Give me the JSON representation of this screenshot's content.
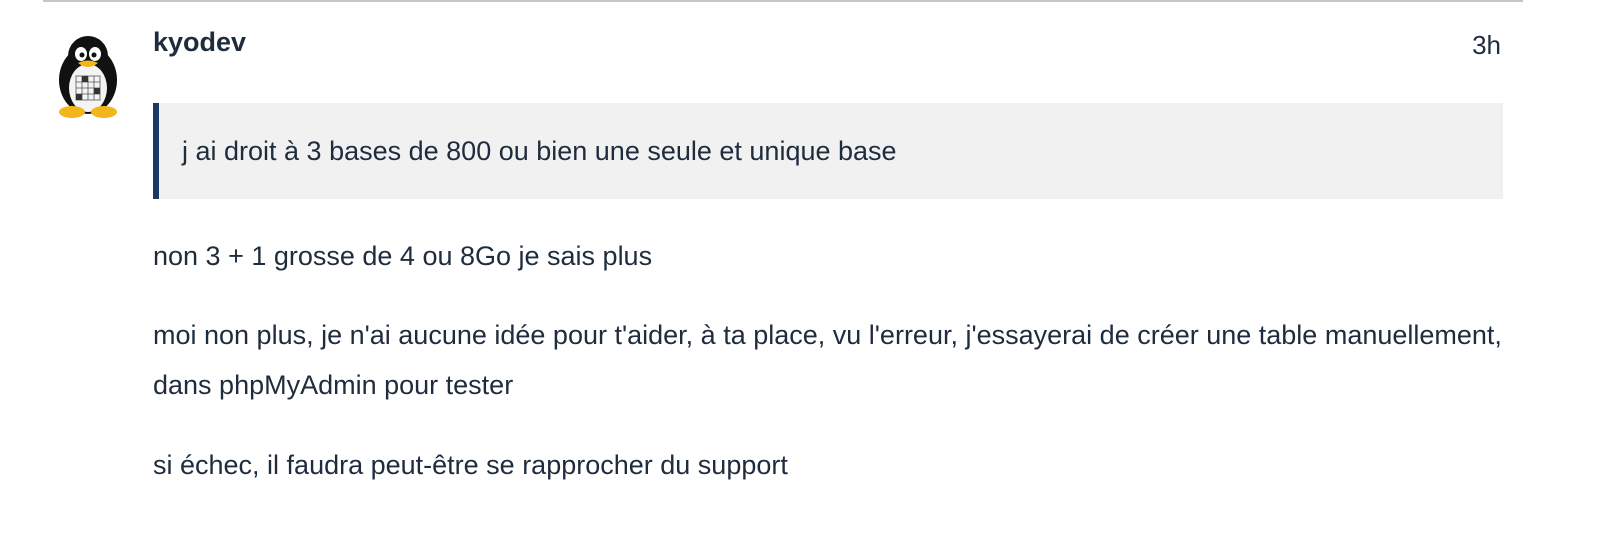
{
  "post": {
    "username": "kyodev",
    "date": "3h",
    "avatar_icon": "tux-penguin-avatar",
    "quote": "j ai droit à 3 bases de 800 ou bien une seule et unique base",
    "paragraphs": [
      "non 3 + 1 grosse de 4 ou 8Go je sais plus",
      "moi non plus, je n'ai aucune idée pour t'aider, à ta place, vu l'erreur, j'essayerai de créer une table manuellement, dans phpMyAdmin pour tester",
      "si échec, il faudra peut-être se rapprocher du support"
    ]
  },
  "colors": {
    "text": "#1f2c3d",
    "quote_background": "#f1f1f1",
    "quote_border": "#1b3a63",
    "divider": "#c6c6c6"
  }
}
